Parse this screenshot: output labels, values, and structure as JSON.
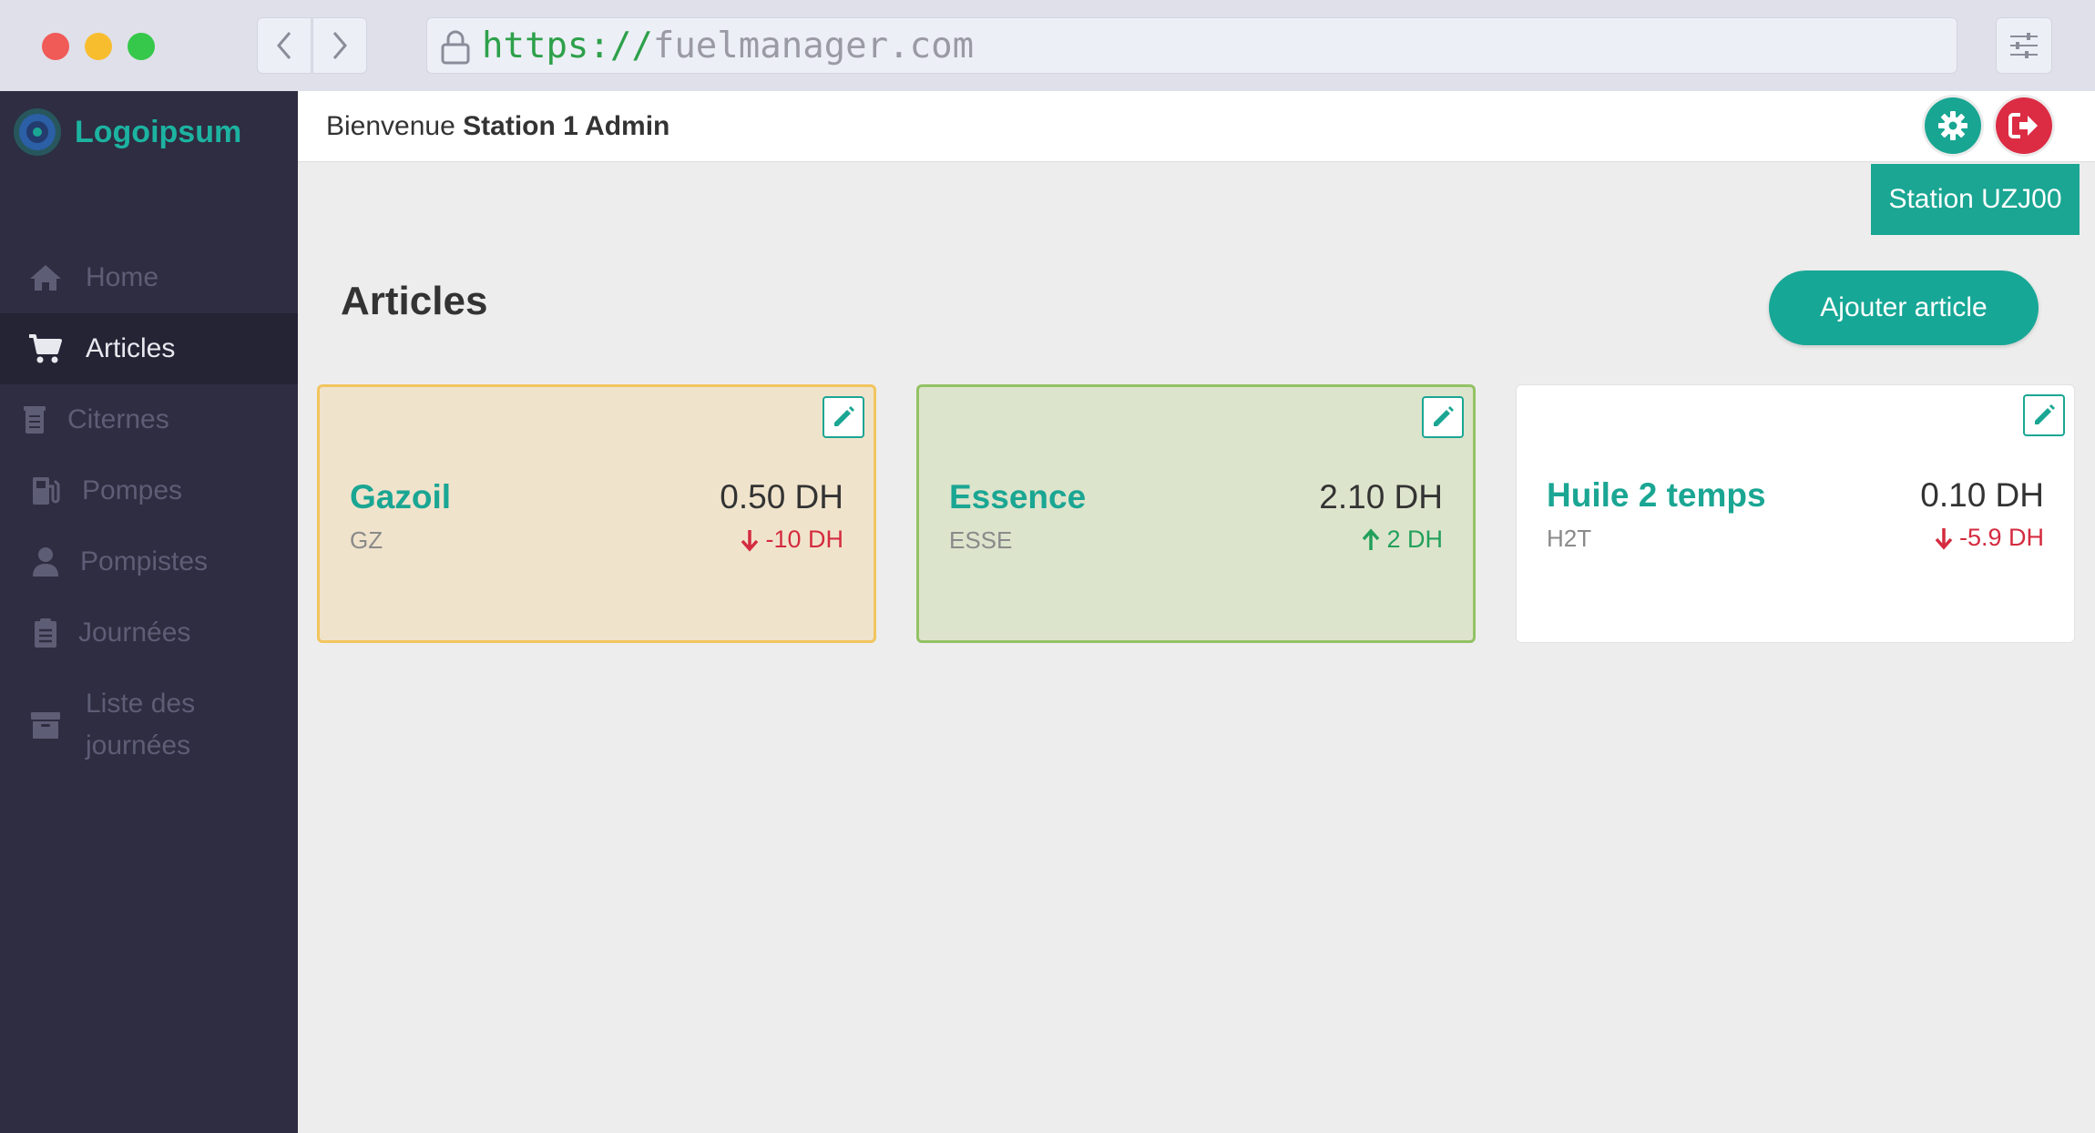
{
  "browser": {
    "url_scheme": "https://",
    "url_host": "fuelmanager.com"
  },
  "sidebar": {
    "logo_text": "Logoipsum",
    "items": [
      {
        "label": "Home",
        "icon": "home-icon"
      },
      {
        "label": "Articles",
        "icon": "cart-icon",
        "active": true
      },
      {
        "label": "Citernes",
        "icon": "tank-icon"
      },
      {
        "label": "Pompes",
        "icon": "gas-pump-icon"
      },
      {
        "label": "Pompistes",
        "icon": "user-icon"
      },
      {
        "label": "Journées",
        "icon": "clipboard-icon"
      },
      {
        "label": "Liste des journées",
        "icon": "archive-icon"
      }
    ]
  },
  "header": {
    "welcome_prefix": "Bienvenue",
    "user_name": "Station 1 Admin",
    "station_badge": "Station UZJ00"
  },
  "main": {
    "title": "Articles",
    "add_button": "Ajouter article",
    "cards": [
      {
        "name": "Gazoil",
        "code": "GZ",
        "price": "0.50 DH",
        "change": "-10 DH",
        "trend": "down"
      },
      {
        "name": "Essence",
        "code": "ESSE",
        "price": "2.10 DH",
        "change": "2 DH",
        "trend": "up"
      },
      {
        "name": "Huile 2 temps",
        "code": "H2T",
        "price": "0.10 DH",
        "change": "-5.9 DH",
        "trend": "down"
      }
    ]
  },
  "colors": {
    "accent": "#1aa693",
    "danger": "#dc2c44",
    "sidebar_bg": "#2e2d41"
  }
}
